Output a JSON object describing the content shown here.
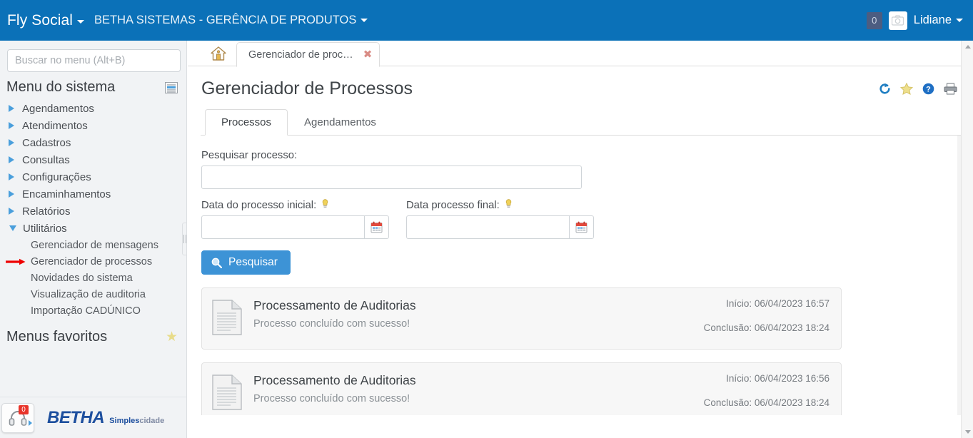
{
  "topbar": {
    "brand": "Fly Social",
    "organization": "BETHA SISTEMAS - GERÊNCIA DE PRODUTOS",
    "message_count": "0",
    "username": "Lidiane",
    "brand_bg": "#0b71b8"
  },
  "sidebar": {
    "search_placeholder": "Buscar no menu (Alt+B)",
    "search_value": "",
    "menu_title": "Menu do sistema",
    "items": [
      {
        "label": "Agendamentos",
        "expanded": false
      },
      {
        "label": "Atendimentos",
        "expanded": false
      },
      {
        "label": "Cadastros",
        "expanded": false
      },
      {
        "label": "Consultas",
        "expanded": false
      },
      {
        "label": "Configurações",
        "expanded": false
      },
      {
        "label": "Encaminhamentos",
        "expanded": false
      },
      {
        "label": "Relatórios",
        "expanded": false
      },
      {
        "label": "Utilitários",
        "expanded": true
      }
    ],
    "submenu": [
      {
        "label": "Gerenciador de mensagens",
        "highlighted": false
      },
      {
        "label": "Gerenciador de processos",
        "highlighted": true
      },
      {
        "label": "Novidades do sistema",
        "highlighted": false
      },
      {
        "label": "Visualização de auditoria",
        "highlighted": false
      },
      {
        "label": "Importação CADÚNICO",
        "highlighted": false
      }
    ],
    "favorites_title": "Menus favoritos",
    "footer": {
      "support_badge": "0",
      "logo_main": "BETHA",
      "logo_sub_1": "Simples",
      "logo_sub_2": "cidade"
    }
  },
  "tabstrip": {
    "home_tab_name": "Início",
    "tabs": [
      {
        "label": "Gerenciador de proc…",
        "active": true,
        "close": "✖"
      }
    ]
  },
  "page": {
    "title": "Gerenciador de Processos",
    "icons": [
      "refresh-icon",
      "star-icon",
      "help-icon",
      "print-icon"
    ]
  },
  "inner_tabs": [
    {
      "label": "Processos",
      "active": true
    },
    {
      "label": "Agendamentos",
      "active": false
    }
  ],
  "form": {
    "search_label": "Pesquisar processo:",
    "search_value": "",
    "date_start_label": "Data do processo inicial:",
    "date_start_value": "",
    "date_end_label": "Data processo final:",
    "date_end_value": "",
    "submit_label": "Pesquisar"
  },
  "results": [
    {
      "title": "Processamento de Auditorias",
      "status": "Processo concluído com sucesso!",
      "start": "Início: 06/04/2023 16:57",
      "end": "Conclusão: 06/04/2023 18:24"
    },
    {
      "title": "Processamento de Auditorias",
      "status": "Processo concluído com sucesso!",
      "start": "Início: 06/04/2023 16:56",
      "end": "Conclusão: 06/04/2023 18:24"
    }
  ]
}
